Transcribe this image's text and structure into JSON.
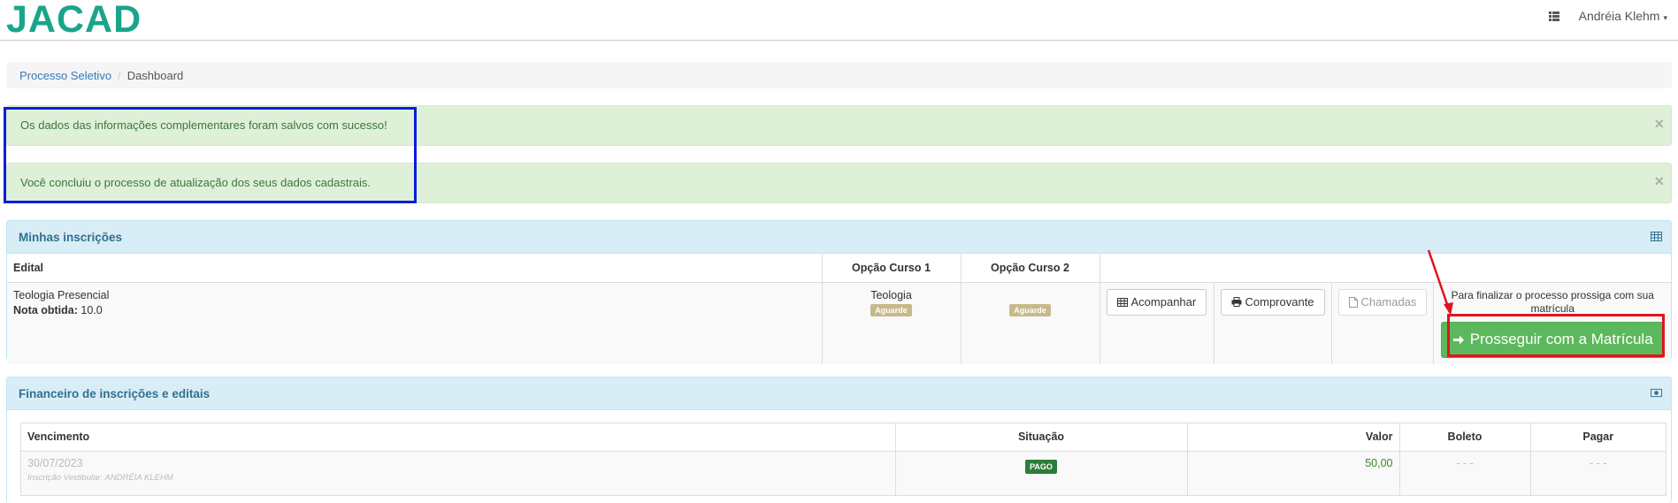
{
  "brand": {
    "logo_text": "JACAD",
    "logo_color": "#1aa58a"
  },
  "nav": {
    "list_icon": "list-icon",
    "user_name": "Andréia Klehm",
    "user_caret": "▾"
  },
  "breadcrumb": {
    "items": [
      "Processo Seletivo",
      "Dashboard"
    ],
    "separator": "/"
  },
  "alerts": [
    {
      "text": "Os dados das informações complementares foram salvos com sucesso!",
      "close": "×"
    },
    {
      "text": "Você concluiu o processo de atualização dos seus dados cadastrais.",
      "close": "×"
    }
  ],
  "inscricoes": {
    "title": "Minhas inscrições",
    "icon": "table-icon",
    "headers": [
      "Edital",
      "Opção Curso 1",
      "Opção Curso 2"
    ],
    "row": {
      "edital": "Teologia Presencial",
      "nota_label": "Nota obtida:",
      "nota_value": "10.0",
      "curso1": "Teologia",
      "curso1_status": "Aguarde",
      "curso2_status": "Aguarde",
      "btn_acompanhar": "Acompanhar",
      "btn_comprovante": "Comprovante",
      "btn_chamadas": "Chamadas",
      "finalizar_text": "Para finalizar o processo prossiga com sua matrícula",
      "btn_prosseguir": "Prosseguir com a Matrícula"
    }
  },
  "financeiro": {
    "title": "Financeiro de inscrições e editais",
    "icon": "money-icon",
    "headers": [
      "Vencimento",
      "Situação",
      "Valor",
      "Boleto",
      "Pagar"
    ],
    "row": {
      "vencimento": "30/07/2023",
      "descricao": "Inscrição Vestibular: ANDRÉIA KLEHM",
      "situacao": "PAGO",
      "valor": "50,00",
      "boleto": "- - -",
      "pagar": "- - -"
    }
  },
  "colors": {
    "success": "#5cb85c",
    "alert_bg": "#dff0d8",
    "panel_heading": "#d9edf7",
    "annotation_blue": "#0a1ed8",
    "annotation_red": "#e0141e"
  }
}
